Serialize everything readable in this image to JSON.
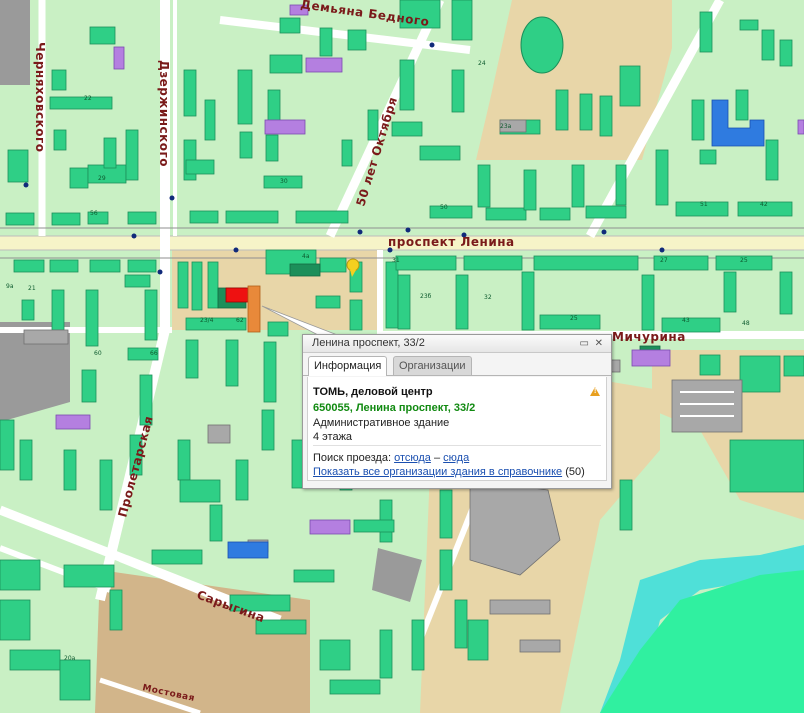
{
  "colors": {
    "background": "#c9f0c4",
    "building": "#2fcf86",
    "building_dark": "#1c8f5a",
    "admin_building": "#b47fe0",
    "school_block": "#2f7be0",
    "road": "#ffffff",
    "main_road": "#f6f4c8",
    "park_sand": "#e8d6a8",
    "industrial": "#d2b58a",
    "river": "#4fe0d8",
    "gray_area": "#9a9a9a",
    "selected_building": "#ee1111",
    "station_marker": "#102a7a"
  },
  "streets": {
    "lenina": "проспект Ленина",
    "oktyabrya": "50 лет Октября",
    "dzerzhinskogo": "Дзержинского",
    "chernyakhovskogo": "Черняховского",
    "bednogo": "Демьяна Бедного",
    "michurina": "Мичурина",
    "proletarskaya": "Пролетарская",
    "sarygina": "Сарыгина",
    "mostovaya": "Мостовая"
  },
  "building_numbers": [
    "24",
    "29",
    "30",
    "22",
    "56",
    "51",
    "42",
    "23б",
    "32",
    "25",
    "43",
    "48",
    "4а",
    "9а",
    "60",
    "66",
    "62",
    "20а",
    "23/4",
    "23а",
    "21",
    "27",
    "25",
    "31",
    "50"
  ],
  "popup": {
    "title": "Ленина проспект, 33/2",
    "tabs": [
      "Информация",
      "Организации"
    ],
    "active_tab": "Информация",
    "name": "ТОМЬ, деловой центр",
    "address": "650055, Ленина проспект, 33/2",
    "type": "Административное здание",
    "floors": "4 этажа",
    "route_label": "Поиск проезда:",
    "route_from": "отсюда",
    "route_dash": "–",
    "route_to": "сюда",
    "orgs_link": "Показать все организации здания в справочнике",
    "orgs_count": "(50)"
  }
}
